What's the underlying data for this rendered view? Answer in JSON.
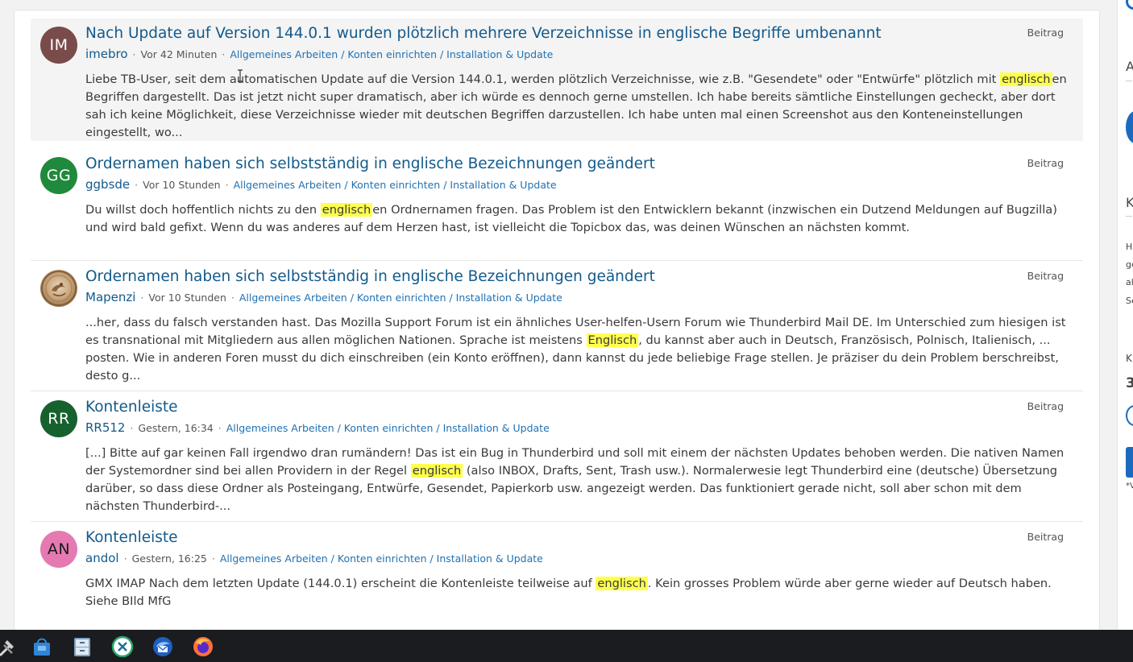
{
  "results": [
    {
      "avatar": {
        "initials": "IM",
        "color": "#7a4b4b"
      },
      "title": "Nach Update auf Version 144.0.1 wurden plötzlich mehrere Verzeichnisse in englische Begriffe umbenannt",
      "author": "imebro",
      "time": "Vor 42 Minuten",
      "breadcrumb": "Allgemeines Arbeiten / Konten einrichten / Installation & Update",
      "type": "Beitrag",
      "text_before": "Liebe TB-User, seit dem automatischen Update auf die Version 144.0.1, werden plötzlich Verzeichnisse, wie z.B. \"Gesendete\" oder \"Entwürfe\" plötzlich mit ",
      "highlight": "englisch",
      "text_after": "en Begriffen dargestellt. Das ist jetzt nicht super dramatisch, aber ich würde es dennoch gerne umstellen. Ich habe bereits sämtliche Einstellungen gecheckt, aber dort sah ich keine Möglichkeit, diese Verzeichnisse wieder mit deutschen Begriffen darzustellen. Ich habe unten mal einen Screenshot aus den Konteneinstellungen eingestellt, wo..."
    },
    {
      "avatar": {
        "initials": "GG",
        "color": "#1f8a3b"
      },
      "title": "Ordernamen haben sich selbstständig in englische Bezeichnungen geändert",
      "author": "ggbsde",
      "time": "Vor 10 Stunden",
      "breadcrumb": "Allgemeines Arbeiten / Konten einrichten / Installation & Update",
      "type": "Beitrag",
      "text_before": "Du willst doch hoffentlich nichts zu den ",
      "highlight": "englisch",
      "text_after": "en Ordnernamen fragen. Das Problem ist den Entwicklern bekannt (inzwischen ein Dutzend Meldungen auf Bugzilla) und wird bald gefixt. Wenn du was anderes auf dem Herzen hast, ist vielleicht die Topicbox das, was deinen Wünschen an nächsten kommt."
    },
    {
      "avatar": {
        "initials": "",
        "color": "#c8a47a"
      },
      "title": "Ordernamen haben sich selbstständig in englische Bezeichnungen geändert",
      "author": "Mapenzi",
      "time": "Vor 10 Stunden",
      "breadcrumb": "Allgemeines Arbeiten / Konten einrichten / Installation & Update",
      "type": "Beitrag",
      "text_before": "...her, dass du falsch verstanden hast. Das Mozilla Support Forum ist ein ähnliches User-helfen-Usern Forum wie Thunderbird Mail DE. Im Unterschied zum hiesigen ist es transnational mit Mitgliedern aus allen möglichen Nationen. Sprache ist meistens ",
      "highlight": "Englisch",
      "text_after": ", du kannst aber auch in Deutsch, Französisch, Polnisch, Italienisch, ... posten. Wie in anderen Foren musst du dich einschreiben (ein Konto eröffnen), dann kannst du jede beliebige Frage stellen. Je präziser du dein Problem berschreibst, desto g..."
    },
    {
      "avatar": {
        "initials": "RR",
        "color": "#17612f"
      },
      "title": "Kontenleiste",
      "author": "RR512",
      "time": "Gestern, 16:34",
      "breadcrumb": "Allgemeines Arbeiten / Konten einrichten / Installation & Update",
      "type": "Beitrag",
      "text_before": "[...] Bitte auf gar keinen Fall irgendwo dran rumändern! Das ist ein Bug in Thunderbird und soll mit einem der nächsten Updates behoben werden. Die nativen Namen der Systemordner sind bei allen Providern in der Regel ",
      "highlight": "englisch",
      "text_after": " (also INBOX, Drafts, Sent, Trash usw.). Normalerwesie legt Thunderbird eine (deutsche) Übersetzung darüber, so dass diese Ordner als Posteingang, Entwürfe, Gesendet, Papierkorb usw. angezeigt werden. Das funktioniert gerade nicht, soll aber schon mit dem nächsten Thunderbird-..."
    },
    {
      "avatar": {
        "initials": "AN",
        "color": "#e47ab1"
      },
      "title": "Kontenleiste",
      "author": "andol",
      "time": "Gestern, 16:25",
      "breadcrumb": "Allgemeines Arbeiten / Konten einrichten / Installation & Update",
      "type": "Beitrag",
      "text_before": "GMX IMAP Nach dem letzten Update (144.0.1) erscheint die Kontenleiste teilweise auf ",
      "highlight": "englisch",
      "text_after": ". Kein grosses Problem würde aber gerne wieder auf Deutsch haben. Siehe BIld MfG"
    }
  ],
  "sidebar_fragments": [
    "A",
    "K",
    "Hi",
    "ge",
    "ak",
    "Se",
    "K",
    "3",
    "*V"
  ],
  "taskbar": {
    "items": [
      "tools-icon",
      "store-icon",
      "file-manager-icon",
      "app-icon",
      "thunderbird-icon",
      "firefox-icon"
    ]
  }
}
